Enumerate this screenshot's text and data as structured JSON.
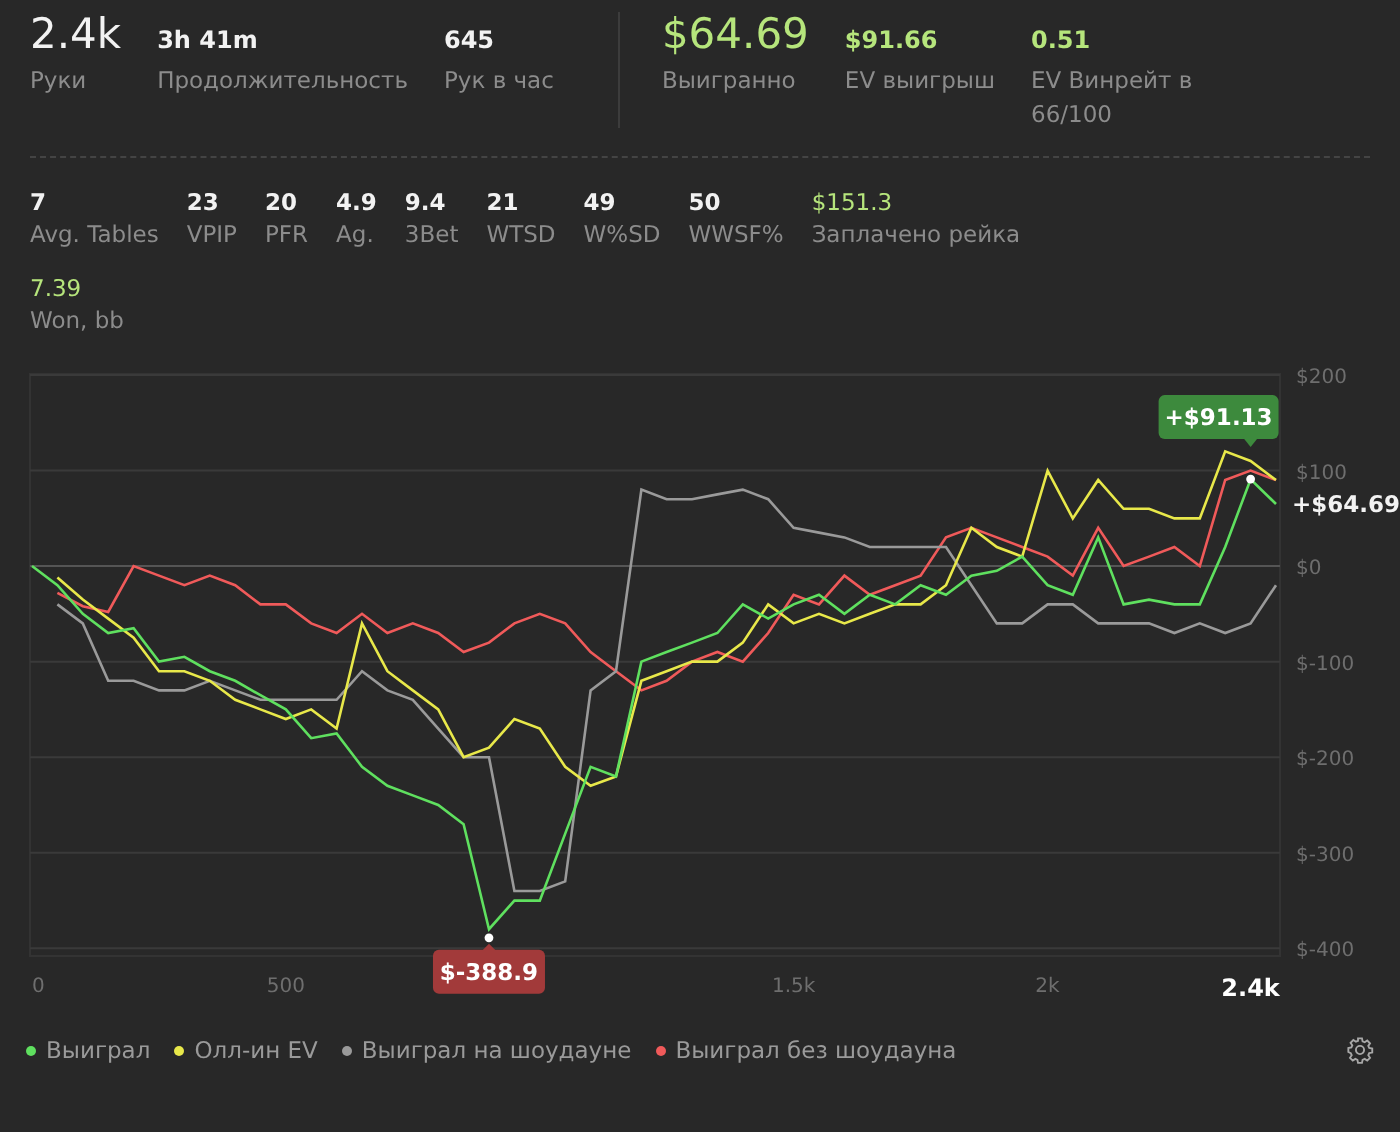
{
  "summary": {
    "left": [
      {
        "kind": "big",
        "highlight": false,
        "value": "2.4k",
        "label": "Руки"
      },
      {
        "kind": "small",
        "highlight": false,
        "value": "3h 41m",
        "label": "Продолжительность"
      },
      {
        "kind": "small",
        "highlight": false,
        "value": "645",
        "label": "Рук в час"
      }
    ],
    "right": [
      {
        "kind": "big",
        "highlight": true,
        "value": "$64.69",
        "label": "Выигранно"
      },
      {
        "kind": "small",
        "highlight": true,
        "value": "$91.66",
        "label": "EV выигрыш"
      },
      {
        "kind": "small",
        "highlight": true,
        "value": "0.51",
        "label": "EV Винрейт в 66/100"
      }
    ]
  },
  "stats": [
    {
      "value": "7",
      "label": "Avg. Tables",
      "highlight": false
    },
    {
      "value": "23",
      "label": "VPIP",
      "highlight": false
    },
    {
      "value": "20",
      "label": "PFR",
      "highlight": false
    },
    {
      "value": "4.9",
      "label": "Ag.",
      "highlight": false
    },
    {
      "value": "9.4",
      "label": "3Bet",
      "highlight": false
    },
    {
      "value": "21",
      "label": "WTSD",
      "highlight": false
    },
    {
      "value": "49",
      "label": "W%SD",
      "highlight": false
    },
    {
      "value": "50",
      "label": "WWSF%",
      "highlight": false
    },
    {
      "value": "$151.3",
      "label": "Заплачено рейка",
      "highlight": true
    }
  ],
  "stats2": [
    {
      "value": "7.39",
      "label": "Won, bb",
      "highlight": true
    }
  ],
  "chart": {
    "chart_data": {
      "type": "line",
      "x": [
        0,
        50,
        100,
        150,
        200,
        250,
        300,
        350,
        400,
        450,
        500,
        550,
        600,
        650,
        700,
        750,
        800,
        850,
        900,
        950,
        1000,
        1050,
        1100,
        1150,
        1200,
        1250,
        1300,
        1350,
        1400,
        1450,
        1500,
        1550,
        1600,
        1650,
        1700,
        1750,
        1800,
        1850,
        1900,
        1950,
        2000,
        2050,
        2100,
        2150,
        2200,
        2250,
        2300,
        2350,
        2400,
        2450
      ],
      "series": [
        {
          "name": "Выиграл",
          "color": "#5fe05f",
          "values": [
            0,
            -20,
            -50,
            -70,
            -65,
            -100,
            -95,
            -110,
            -120,
            -135,
            -150,
            -180,
            -175,
            -210,
            -230,
            -240,
            -250,
            -270,
            -380,
            -350,
            -350,
            -280,
            -210,
            -220,
            -100,
            -90,
            -80,
            -70,
            -40,
            -55,
            -40,
            -30,
            -50,
            -30,
            -40,
            -20,
            -30,
            -10,
            -5,
            10,
            -20,
            -30,
            30,
            -40,
            -35,
            -40,
            -40,
            20,
            91,
            65
          ]
        },
        {
          "name": "Олл-ин EV",
          "color": "#e8e84a",
          "values": [
            null,
            -12,
            -35,
            -55,
            -75,
            -110,
            -110,
            -120,
            -140,
            -150,
            -160,
            -150,
            -170,
            -60,
            -110,
            -130,
            -150,
            -200,
            -190,
            -160,
            -170,
            -210,
            -230,
            -220,
            -120,
            -110,
            -100,
            -100,
            -80,
            -40,
            -60,
            -50,
            -60,
            -50,
            -40,
            -40,
            -20,
            40,
            20,
            10,
            100,
            50,
            90,
            60,
            60,
            50,
            50,
            120,
            110,
            90
          ]
        },
        {
          "name": "Выиграл на шоудауне",
          "color": "#9a9a9a",
          "values": [
            null,
            -40,
            -60,
            -120,
            -120,
            -130,
            -130,
            -120,
            -130,
            -140,
            -140,
            -140,
            -140,
            -110,
            -130,
            -140,
            -170,
            -200,
            -200,
            -340,
            -340,
            -330,
            -130,
            -110,
            80,
            70,
            70,
            75,
            80,
            70,
            40,
            35,
            30,
            20,
            20,
            20,
            20,
            -20,
            -60,
            -60,
            -40,
            -40,
            -60,
            -60,
            -60,
            -70,
            -60,
            -70,
            -60,
            -20
          ]
        },
        {
          "name": "Выиграл без шоудауна",
          "color": "#f05a5a",
          "values": [
            null,
            -28,
            -42,
            -48,
            0,
            -10,
            -20,
            -10,
            -20,
            -40,
            -40,
            -60,
            -70,
            -50,
            -70,
            -60,
            -70,
            -90,
            -80,
            -60,
            -50,
            -60,
            -90,
            -110,
            -130,
            -120,
            -100,
            -90,
            -100,
            -70,
            -30,
            -40,
            -10,
            -30,
            -20,
            -10,
            30,
            40,
            30,
            20,
            10,
            -10,
            40,
            0,
            10,
            20,
            0,
            90,
            100,
            90
          ]
        }
      ],
      "xlim": [
        0,
        2450
      ],
      "ylim": [
        -408,
        201
      ],
      "grid": true,
      "xticks": [
        0,
        500,
        {
          "value": 1500,
          "label": "1.5k"
        },
        {
          "value": 2000,
          "label": "2k"
        },
        {
          "value": 2400,
          "label": "2.4k"
        }
      ],
      "yticks": [
        {
          "value": 200,
          "label": "$200"
        },
        {
          "value": 100,
          "label": "$100"
        },
        {
          "value": 0,
          "label": "$0"
        },
        {
          "value": -100,
          "label": "$-100"
        },
        {
          "value": -200,
          "label": "$-200"
        },
        {
          "value": -300,
          "label": "$-300"
        },
        {
          "value": -400,
          "label": "$-400"
        }
      ],
      "annotations": [
        {
          "text": "+$91.13",
          "x": 2400,
          "y": 91
        },
        {
          "text": "+$64.69",
          "x": 2450,
          "y": 65
        },
        {
          "text": "$-388.9",
          "x": 900,
          "y": -389
        }
      ]
    }
  }
}
